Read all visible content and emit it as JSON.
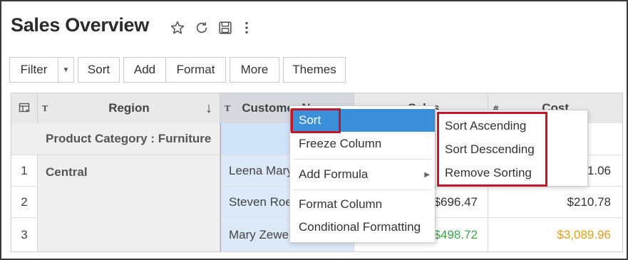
{
  "header": {
    "title": "Sales Overview"
  },
  "icons": {
    "favorite": "star-icon",
    "refresh": "refresh-icon",
    "save": "save-icon",
    "more": "kebab-icon"
  },
  "toolbar": {
    "filter": "Filter",
    "sort": "Sort",
    "add": "Add",
    "format": "Format",
    "more": "More",
    "themes": "Themes"
  },
  "table": {
    "columns": [
      {
        "type": "T",
        "label": "Region",
        "sort": "↓"
      },
      {
        "type": "T",
        "label": "Customer Name"
      },
      {
        "type": "#",
        "label": "Sales"
      },
      {
        "type": "#",
        "label": "Cost"
      }
    ],
    "group_label": "Product Category : Furniture",
    "rows": [
      {
        "num": "1",
        "region": "Central",
        "customer": "Leena Mary",
        "sales": "",
        "cost": "$1.06"
      },
      {
        "num": "2",
        "region": "",
        "customer": "Steven Roe",
        "sales": "$696.47",
        "cost": "$210.78"
      },
      {
        "num": "3",
        "region": "",
        "customer": "Mary Zewe",
        "sales": "$498.72",
        "cost": "$3,089.96"
      }
    ]
  },
  "context_menu": {
    "items": [
      "Sort",
      "Freeze Column",
      "Add Formula",
      "Format Column",
      "Conditional Formatting"
    ]
  },
  "submenu": {
    "items": [
      "Sort Ascending",
      "Sort Descending",
      "Remove Sorting"
    ]
  },
  "colors": {
    "accent": "#3a8fd8",
    "highlight": "#c0182a",
    "positive": "#3fa24a",
    "warning": "#d9a21a"
  }
}
